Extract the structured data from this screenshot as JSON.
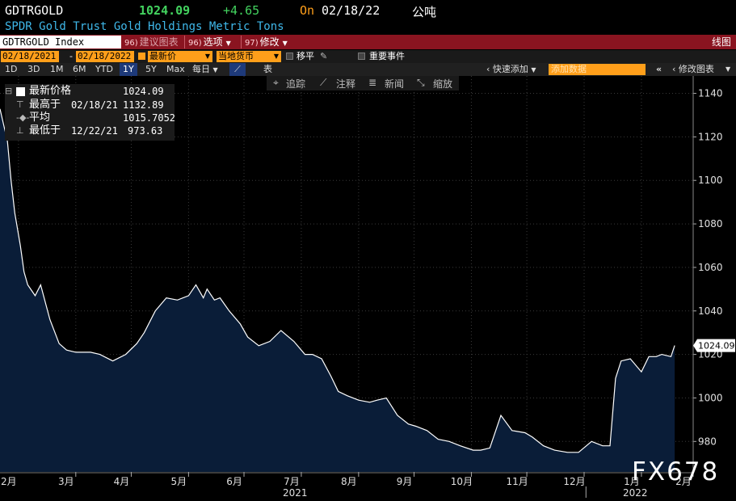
{
  "header": {
    "ticker": "GDTRGOLD",
    "last": "1024.09",
    "change": "+4.65",
    "on_label": "On",
    "on_date": "02/18/22",
    "unit": "公吨",
    "subtitle": "SPDR Gold Trust Gold Holdings Metric Tons"
  },
  "toolbar": {
    "index": "GDTRGOLD Index",
    "suggest_num": "96)",
    "suggest": "建议图表",
    "options_num": "96)",
    "options": "选项",
    "edit_num": "97)",
    "edit": "修改",
    "line_chart": "线图"
  },
  "controls": {
    "date_from": "02/18/2021",
    "date_to": "02/18/2022",
    "field": "最新价",
    "currency": "当地货币",
    "move_avg": "移平",
    "events": "重要事件"
  },
  "periods": [
    "1D",
    "3D",
    "1M",
    "6M",
    "YTD",
    "1Y",
    "5Y",
    "Max"
  ],
  "period_selected": "1Y",
  "frequency": "每日",
  "table_label": "表",
  "quick_add": "快速添加",
  "add_data_placeholder": "添加数据",
  "modify_chart": "修改图表",
  "chart_tools": [
    "追踪",
    "注释",
    "新闻",
    "缩放"
  ],
  "legend": {
    "last_label": "最新价格",
    "last_value": "1024.09",
    "high_label": "最高于",
    "high_date": "02/18/21",
    "high_value": "1132.89",
    "avg_label": "平均",
    "avg_value": "1015.7052",
    "low_label": "最低于",
    "low_date": "12/22/21",
    "low_value": "973.63"
  },
  "watermark": "FX678",
  "chart_data": {
    "type": "area",
    "ylim": [
      966,
      1148
    ],
    "yticks": [
      980,
      1000,
      1020,
      1040,
      1060,
      1080,
      1100,
      1120,
      1140
    ],
    "xlim": [
      "2021-02-18",
      "2022-02-28"
    ],
    "month_labels": [
      {
        "label": "2月",
        "date": "2021-02-28"
      },
      {
        "label": "3月",
        "date": "2021-03-31"
      },
      {
        "label": "4月",
        "date": "2021-04-30"
      },
      {
        "label": "5月",
        "date": "2021-05-31"
      },
      {
        "label": "6月",
        "date": "2021-06-30"
      },
      {
        "label": "7月",
        "date": "2021-07-31"
      },
      {
        "label": "8月",
        "date": "2021-08-31"
      },
      {
        "label": "9月",
        "date": "2021-09-30"
      },
      {
        "label": "10月",
        "date": "2021-10-31"
      },
      {
        "label": "11月",
        "date": "2021-11-30"
      },
      {
        "label": "12月",
        "date": "2021-12-31"
      },
      {
        "label": "1月",
        "date": "2022-01-31"
      },
      {
        "label": "2月",
        "date": "2022-02-28"
      }
    ],
    "year_labels": [
      {
        "label": "2021",
        "date": "2021-08-01"
      },
      {
        "label": "2022",
        "date": "2022-02-01"
      }
    ],
    "last_value_label": "1024.09",
    "series": [
      {
        "x": [
          "2021-02-18",
          "2021-02-22",
          "2021-02-24",
          "2021-02-26",
          "2021-03-01",
          "2021-03-03",
          "2021-03-05",
          "2021-03-09",
          "2021-03-12",
          "2021-03-17",
          "2021-03-22",
          "2021-03-26",
          "2021-03-31",
          "2021-04-05",
          "2021-04-08",
          "2021-04-13",
          "2021-04-20",
          "2021-04-27",
          "2021-05-03",
          "2021-05-07",
          "2021-05-13",
          "2021-05-19",
          "2021-05-25",
          "2021-05-31",
          "2021-06-04",
          "2021-06-08",
          "2021-06-10",
          "2021-06-14",
          "2021-06-17",
          "2021-06-22",
          "2021-06-28",
          "2021-07-02",
          "2021-07-08",
          "2021-07-14",
          "2021-07-20",
          "2021-07-27",
          "2021-08-02",
          "2021-08-06",
          "2021-08-11",
          "2021-08-16",
          "2021-08-20",
          "2021-08-25",
          "2021-08-31",
          "2021-09-06",
          "2021-09-10",
          "2021-09-15",
          "2021-09-21",
          "2021-09-27",
          "2021-10-01",
          "2021-10-07",
          "2021-10-13",
          "2021-10-19",
          "2021-10-25",
          "2021-11-01",
          "2021-11-05",
          "2021-11-10",
          "2021-11-16",
          "2021-11-22",
          "2021-11-29",
          "2021-12-03",
          "2021-12-09",
          "2021-12-15",
          "2021-12-22",
          "2021-12-28",
          "2022-01-04",
          "2022-01-10",
          "2022-01-14",
          "2022-01-17",
          "2022-01-20",
          "2022-01-25",
          "2022-01-31",
          "2022-02-04",
          "2022-02-08",
          "2022-02-11",
          "2022-02-16",
          "2022-02-18"
        ],
        "y": [
          1132.89,
          1118,
          1100,
          1085,
          1070,
          1058,
          1052,
          1047,
          1052,
          1036,
          1025,
          1022,
          1021,
          1021,
          1021,
          1020,
          1017,
          1020,
          1025,
          1030,
          1040,
          1046,
          1045,
          1047,
          1052,
          1046,
          1050,
          1045,
          1046,
          1040,
          1034,
          1028,
          1024,
          1026,
          1031,
          1026,
          1020,
          1020,
          1018,
          1010,
          1003,
          1001,
          999,
          998,
          999,
          1000,
          992,
          988,
          987,
          985,
          981,
          980,
          978,
          976,
          976,
          977,
          992,
          985,
          984,
          982,
          978,
          976,
          975,
          975,
          980,
          978,
          978,
          1009,
          1017,
          1018,
          1012,
          1019,
          1019,
          1020,
          1019,
          1024.09
        ]
      }
    ]
  }
}
